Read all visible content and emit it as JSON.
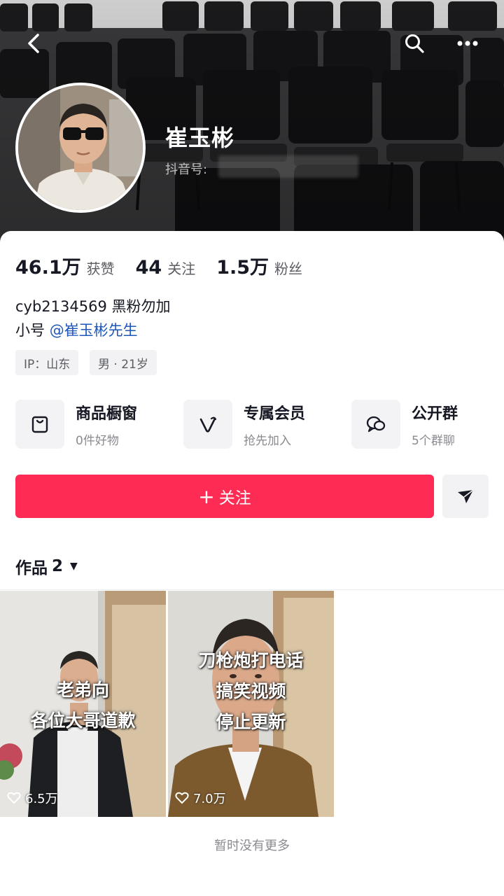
{
  "header": {
    "nickname": "崔玉彬",
    "douyin_id_label": "抖音号:",
    "icons": [
      "back-icon",
      "search-icon",
      "more-icon"
    ]
  },
  "stats": [
    {
      "value": "46.1万",
      "label": "获赞"
    },
    {
      "value": "44",
      "label": "关注"
    },
    {
      "value": "1.5万",
      "label": "粉丝"
    }
  ],
  "bio": {
    "line1": "cyb2134569 黑粉勿加",
    "line2_prefix": "小号",
    "line2_link": "@崔玉彬先生"
  },
  "tags": {
    "ip": "IP：山东",
    "gender_age": "男 · 21岁"
  },
  "services": [
    {
      "title": "商品橱窗",
      "subtitle": "0件好物",
      "icon": "shop-window-icon"
    },
    {
      "title": "专属会员",
      "subtitle": "抢先加入",
      "icon": "membership-icon"
    },
    {
      "title": "公开群",
      "subtitle": "5个群聊",
      "icon": "group-chat-icon"
    }
  ],
  "actions": {
    "follow_plus": "+",
    "follow_label": "关注",
    "share_icon": "send-icon"
  },
  "works": {
    "label": "作品",
    "count": "2"
  },
  "videos": [
    {
      "caption_lines": [
        "老弟向",
        "各位大哥道歉"
      ],
      "likes": "6.5万"
    },
    {
      "caption_lines": [
        "刀枪炮打电话",
        "搞笑视频",
        "停止更新"
      ],
      "likes": "7.0万"
    }
  ],
  "footer": {
    "no_more": "暂时没有更多"
  },
  "colors": {
    "accent": "#fe2c55",
    "link": "#1f57b8",
    "text": "#161823",
    "muted": "#8a8b91"
  }
}
